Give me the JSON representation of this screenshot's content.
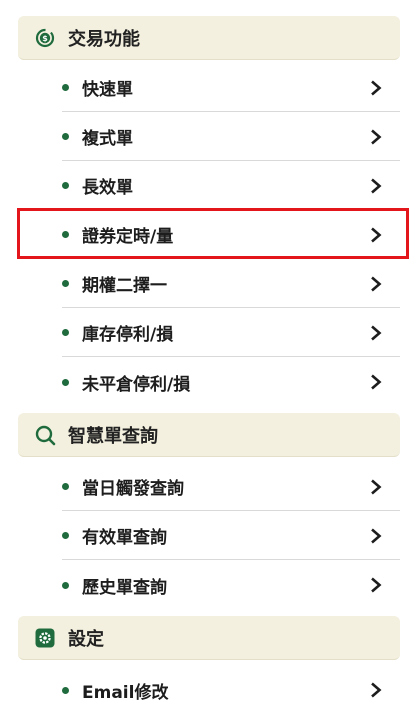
{
  "colors": {
    "accent": "#1f6b3d",
    "section_bg": "#f3f0df",
    "highlight": "#e3161c"
  },
  "sections": [
    {
      "label": "交易功能",
      "icon": "dollar-refresh-icon",
      "items": [
        {
          "label": "快速單"
        },
        {
          "label": "複式單"
        },
        {
          "label": "長效單"
        },
        {
          "label": "證券定時/量"
        },
        {
          "label": "期權二擇一"
        },
        {
          "label": "庫存停利/損"
        },
        {
          "label": "未平倉停利/損"
        }
      ]
    },
    {
      "label": "智慧單查詢",
      "icon": "search-icon",
      "items": [
        {
          "label": "當日觸發查詢"
        },
        {
          "label": "有效單查詢"
        },
        {
          "label": "歷史單查詢"
        }
      ]
    },
    {
      "label": "設定",
      "icon": "gear-icon",
      "items": [
        {
          "label": "Email修改"
        }
      ]
    }
  ],
  "highlighted_item": "證券定時/量"
}
